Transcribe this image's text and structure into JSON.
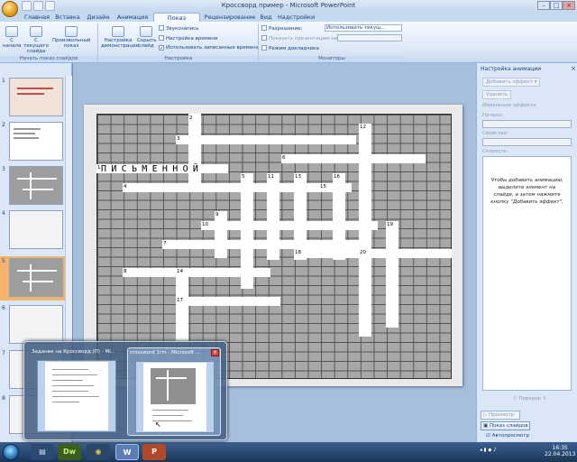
{
  "window": {
    "title": "Кроссворд пример - Microsoft PowerPoint"
  },
  "tabs": [
    "Главная",
    "Вставка",
    "Дизайн",
    "Анимация",
    "Показ слайдов",
    "Рецензирование",
    "Вид",
    "Надстройки"
  ],
  "ribbon": {
    "from_start": "С начала",
    "from_current": "С текущего слайда",
    "custom_show": "Произвольный показ",
    "group_start": "Начать показ слайдов",
    "setup": "Настройка демонстрации",
    "hide_slide": "Скрыть слайд",
    "record_narration": "Звукозапись",
    "rehearse": "Настройка времени",
    "use_timings": "Использовать записанные времена",
    "group_setup": "Настройка",
    "resolution_label": "Разрешение:",
    "resolution_value": "Использовать текущ...",
    "show_on_label": "Показать презентацию на:",
    "presenter_view": "Режим докладчика",
    "group_monitors": "Мониторы"
  },
  "slides": {
    "numbers": [
      "1",
      "2",
      "3",
      "4",
      "5",
      "6",
      "7",
      "8"
    ]
  },
  "crossword": {
    "word": "ПИСЬМЕННОЙ",
    "numbers": [
      "1",
      "2",
      "3",
      "4",
      "5",
      "6",
      "7",
      "8",
      "9",
      "10",
      "11",
      "12",
      "13",
      "14",
      "15",
      "16",
      "17",
      "18",
      "19",
      "20"
    ]
  },
  "anim_panel": {
    "title": "Настройка анимации",
    "add_effect": "Добавить эффект",
    "remove": "Удалить",
    "change_effect": "Изменение эффекта",
    "start": "Начало:",
    "property": "Свойство:",
    "speed": "Скорость:",
    "hint": "Чтобы добавить анимацию, выделите элемент на слайде, а затем нажмите кнопку \"Добавить эффект\".",
    "order": "Порядок",
    "preview": "Просмотр",
    "slideshow": "Показ слайдов",
    "autopreview": "Автопросмотр"
  },
  "taskbar": {
    "time": "16:35",
    "date": "22.04.2013"
  },
  "flyout": {
    "card1": "Задание на Кроссворд (П) - Mi...",
    "card2": "crossword 1rm - Microsoft ..."
  }
}
